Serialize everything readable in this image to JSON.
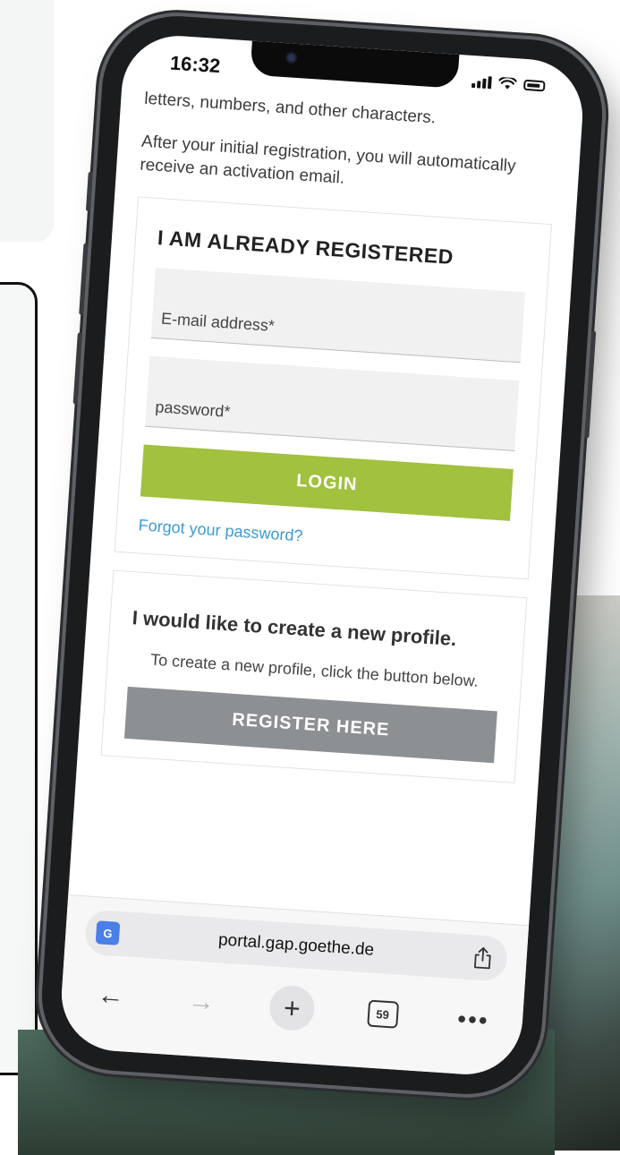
{
  "status_bar": {
    "time": "16:32"
  },
  "page": {
    "intro_line": "letters, numbers, and other characters.",
    "activation_note": "After your initial registration, you will automatically receive an activation email.",
    "login_panel": {
      "title": "I AM ALREADY REGISTERED",
      "email_placeholder": "E-mail address*",
      "password_placeholder": "password*",
      "login_label": "LOGIN",
      "forgot_label": "Forgot your password?"
    },
    "register_panel": {
      "title": "I would like to create a new profile.",
      "description": "To create a new profile, click the button below.",
      "register_label": "REGISTER HERE"
    }
  },
  "browser": {
    "url": "portal.gap.goethe.de",
    "translate_icon_label": "G",
    "tab_count": "59"
  },
  "colors": {
    "login_button": "#a1c13f",
    "register_button": "#8c9092",
    "link": "#3d9bd2"
  }
}
